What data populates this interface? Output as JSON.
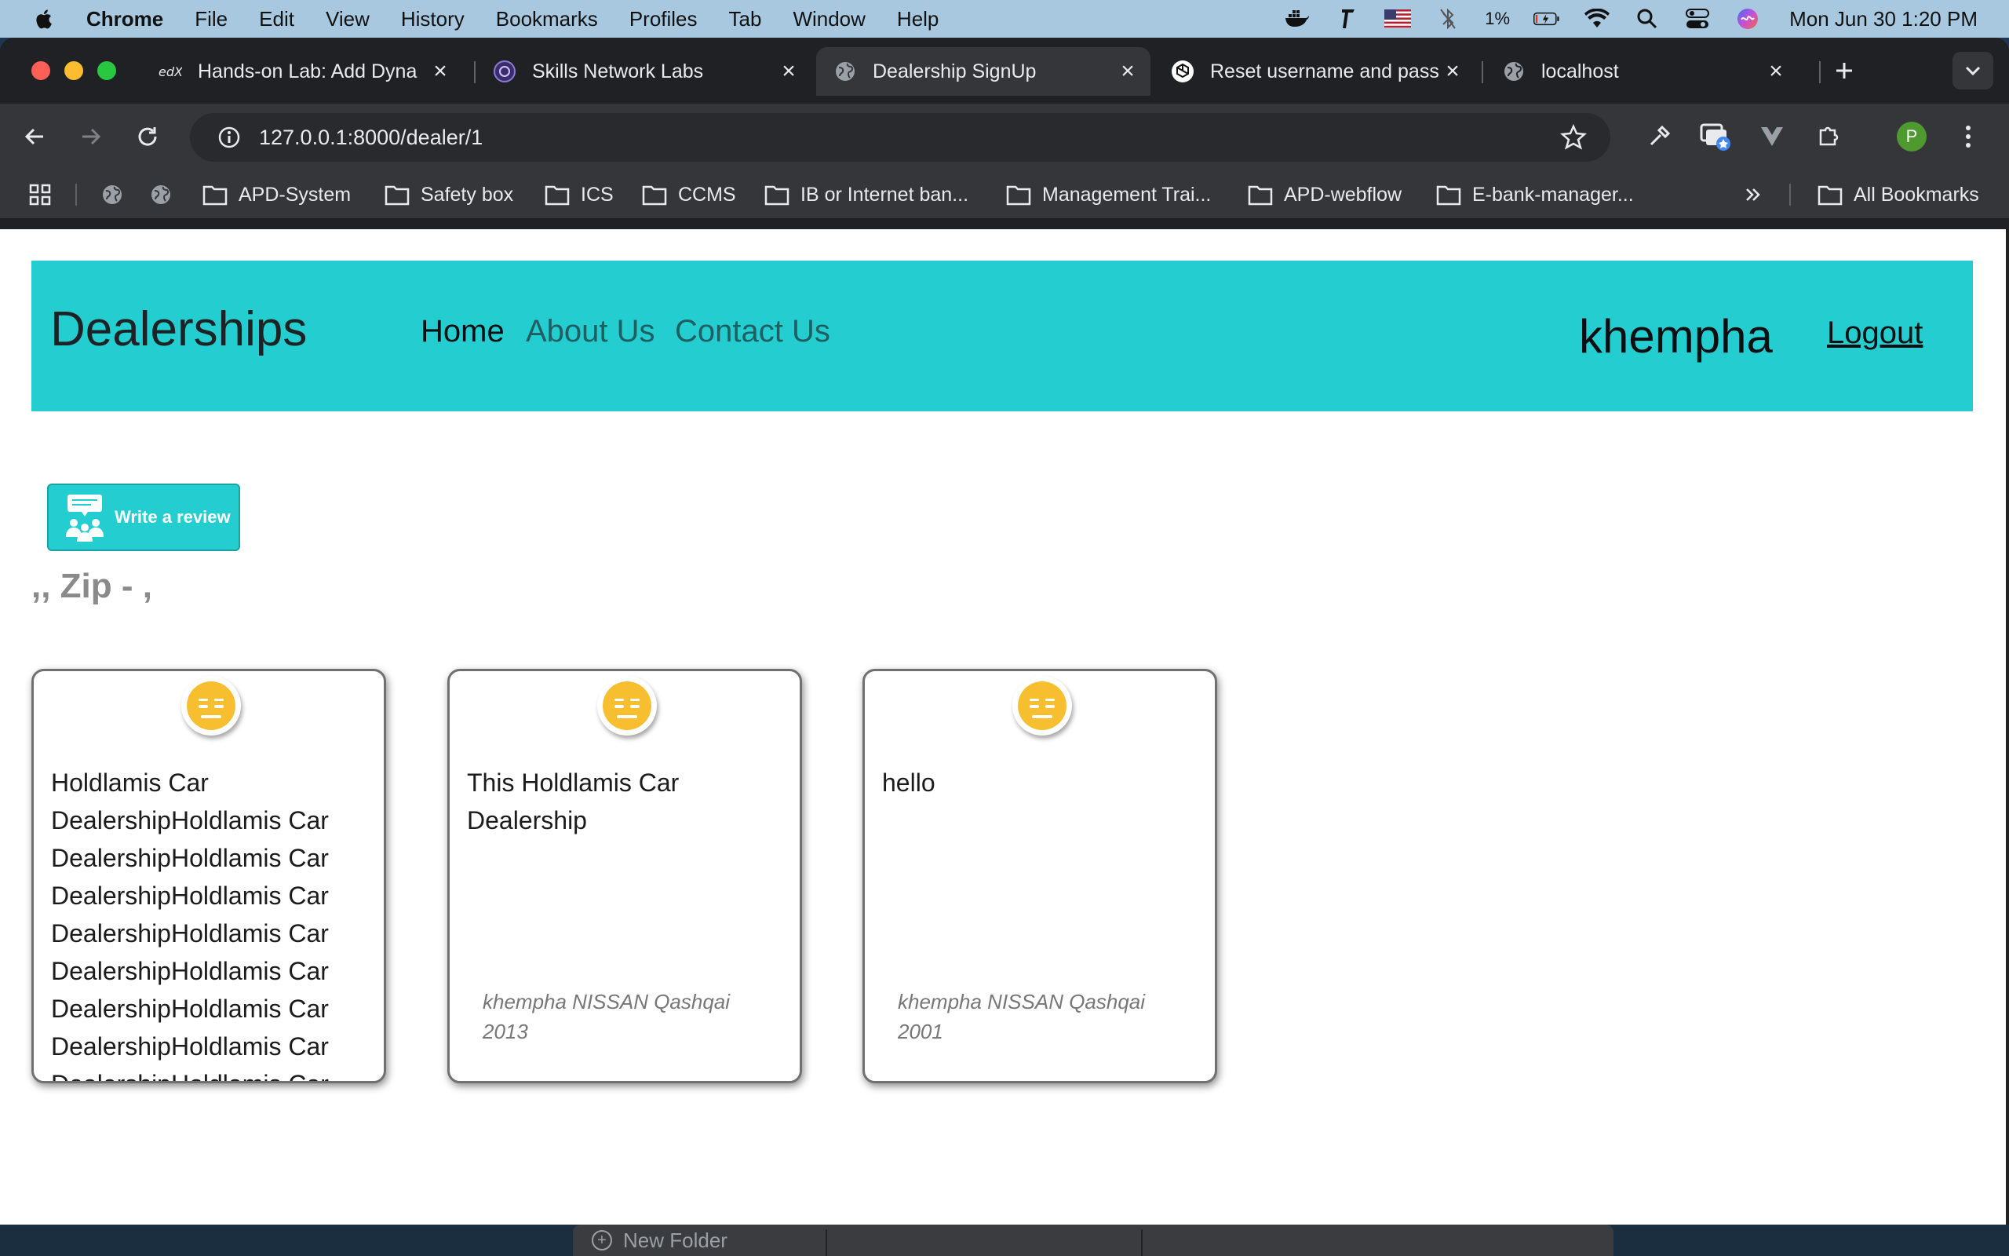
{
  "menubar": {
    "app": "Chrome",
    "items": [
      "File",
      "Edit",
      "View",
      "History",
      "Bookmarks",
      "Profiles",
      "Tab",
      "Window",
      "Help"
    ],
    "battery": "1%",
    "clock": "Mon Jun 30  1:20 PM"
  },
  "tabs": [
    {
      "title": "Hands-on Lab: Add Dyna",
      "icon": "edx-icon"
    },
    {
      "title": "Skills Network Labs",
      "icon": "skills-network-icon"
    },
    {
      "title": "Dealership SignUp",
      "icon": "globe-icon",
      "active": true
    },
    {
      "title": "Reset username and pass",
      "icon": "openai-icon"
    },
    {
      "title": "localhost",
      "icon": "globe-icon"
    }
  ],
  "toolbar": {
    "url": "127.0.0.1:8000/dealer/1",
    "profile_initial": "P"
  },
  "bookmarks": {
    "items": [
      "APD-System",
      "Safety box",
      "ICS",
      "CCMS",
      "IB or Internet ban...",
      "Management Trai...",
      "APD-webflow",
      "E-bank-manager..."
    ],
    "all": "All Bookmarks"
  },
  "page": {
    "brand": "Dealerships",
    "nav": {
      "home": "Home",
      "about": "About Us",
      "contact": "Contact Us"
    },
    "username": "khempha",
    "logout": "Logout",
    "review_button": "Write a review",
    "dealer_address": ",, Zip - ,",
    "reviews": [
      {
        "text": "Holdlamis Car DealershipHoldlamis Car DealershipHoldlamis Car DealershipHoldlamis Car DealershipHoldlamis Car DealershipHoldlamis Car DealershipHoldlamis Car DealershipHoldlamis Car DealershipHoldlamis Car",
        "reviewer": "",
        "sentiment": "neutral"
      },
      {
        "text": "This Holdlamis Car Dealership",
        "reviewer": "khempha NISSAN Qashqai 2013",
        "sentiment": "neutral"
      },
      {
        "text": "hello",
        "reviewer": "khempha NISSAN Qashqai 2001",
        "sentiment": "neutral"
      }
    ]
  },
  "dock": {
    "label": "New Folder"
  },
  "colors": {
    "navbar": "#24cdd0",
    "chrome_dark": "#202124",
    "chrome_toolbar": "#35363a",
    "emoji_yellow": "#f7be2f"
  }
}
